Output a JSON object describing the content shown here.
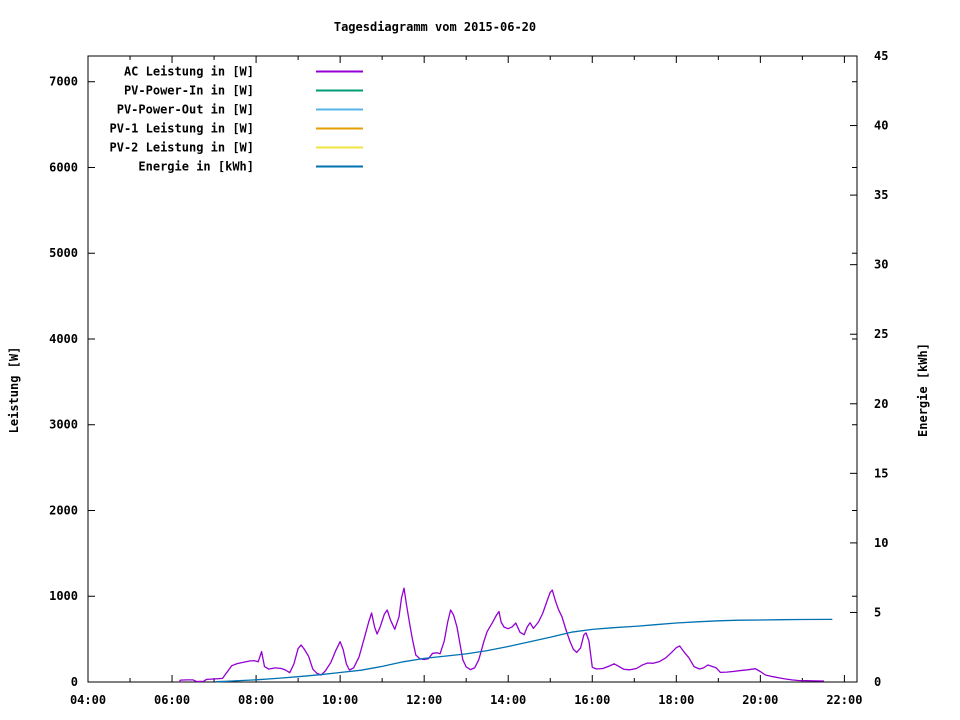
{
  "chart_data": {
    "type": "line",
    "title": "Tagesdiagramm vom 2015-06-20",
    "xlabel": "",
    "ylabel_left": "Leistung [W]",
    "ylabel_right": "Energie [kWh]",
    "grid": false,
    "legend_position": "top-left-inside",
    "x_range_hours": [
      4,
      22.3
    ],
    "x_tick_hours": [
      4,
      6,
      8,
      10,
      12,
      14,
      16,
      18,
      20,
      22
    ],
    "x_tick_labels": [
      "04:00",
      "06:00",
      "08:00",
      "10:00",
      "12:00",
      "14:00",
      "16:00",
      "18:00",
      "20:00",
      "22:00"
    ],
    "x_minor_hours": [
      5,
      7,
      9,
      11,
      13,
      15,
      17,
      19,
      21
    ],
    "y_left_range": [
      0,
      7300
    ],
    "y_left_ticks": [
      0,
      1000,
      2000,
      3000,
      4000,
      5000,
      6000,
      7000
    ],
    "y_right_range": [
      0,
      45
    ],
    "y_right_ticks": [
      0,
      5,
      10,
      15,
      20,
      25,
      30,
      35,
      40,
      45
    ],
    "series": [
      {
        "name": "AC Leistung in [W]",
        "color": "#9400d3",
        "axis": "left",
        "points": [
          [
            6.17,
            0
          ],
          [
            6.2,
            22
          ],
          [
            6.35,
            25
          ],
          [
            6.5,
            25
          ],
          [
            6.58,
            6
          ],
          [
            6.75,
            8
          ],
          [
            6.82,
            30
          ],
          [
            7.0,
            35
          ],
          [
            7.2,
            42
          ],
          [
            7.3,
            110
          ],
          [
            7.42,
            190
          ],
          [
            7.55,
            215
          ],
          [
            7.7,
            230
          ],
          [
            7.85,
            245
          ],
          [
            7.95,
            250
          ],
          [
            8.05,
            235
          ],
          [
            8.13,
            355
          ],
          [
            8.2,
            180
          ],
          [
            8.3,
            150
          ],
          [
            8.45,
            165
          ],
          [
            8.6,
            158
          ],
          [
            8.7,
            140
          ],
          [
            8.8,
            108
          ],
          [
            8.9,
            210
          ],
          [
            9.0,
            390
          ],
          [
            9.07,
            432
          ],
          [
            9.15,
            380
          ],
          [
            9.25,
            300
          ],
          [
            9.35,
            150
          ],
          [
            9.45,
            100
          ],
          [
            9.55,
            82
          ],
          [
            9.65,
            130
          ],
          [
            9.78,
            230
          ],
          [
            9.9,
            370
          ],
          [
            10.0,
            470
          ],
          [
            10.07,
            380
          ],
          [
            10.15,
            210
          ],
          [
            10.22,
            140
          ],
          [
            10.32,
            165
          ],
          [
            10.45,
            290
          ],
          [
            10.58,
            520
          ],
          [
            10.68,
            700
          ],
          [
            10.75,
            805
          ],
          [
            10.82,
            640
          ],
          [
            10.88,
            560
          ],
          [
            10.95,
            640
          ],
          [
            11.05,
            790
          ],
          [
            11.12,
            840
          ],
          [
            11.2,
            720
          ],
          [
            11.3,
            615
          ],
          [
            11.4,
            760
          ],
          [
            11.46,
            980
          ],
          [
            11.52,
            1095
          ],
          [
            11.58,
            900
          ],
          [
            11.65,
            690
          ],
          [
            11.72,
            500
          ],
          [
            11.8,
            315
          ],
          [
            11.9,
            270
          ],
          [
            12.0,
            262
          ],
          [
            12.1,
            272
          ],
          [
            12.2,
            335
          ],
          [
            12.3,
            340
          ],
          [
            12.38,
            330
          ],
          [
            12.48,
            480
          ],
          [
            12.56,
            700
          ],
          [
            12.63,
            840
          ],
          [
            12.7,
            780
          ],
          [
            12.78,
            640
          ],
          [
            12.85,
            450
          ],
          [
            12.92,
            260
          ],
          [
            13.0,
            175
          ],
          [
            13.1,
            145
          ],
          [
            13.2,
            165
          ],
          [
            13.3,
            260
          ],
          [
            13.42,
            470
          ],
          [
            13.5,
            590
          ],
          [
            13.62,
            690
          ],
          [
            13.72,
            780
          ],
          [
            13.78,
            822
          ],
          [
            13.83,
            700
          ],
          [
            13.9,
            640
          ],
          [
            14.0,
            622
          ],
          [
            14.1,
            645
          ],
          [
            14.18,
            688
          ],
          [
            14.28,
            580
          ],
          [
            14.38,
            552
          ],
          [
            14.45,
            640
          ],
          [
            14.52,
            690
          ],
          [
            14.6,
            625
          ],
          [
            14.72,
            700
          ],
          [
            14.82,
            800
          ],
          [
            14.92,
            940
          ],
          [
            15.0,
            1045
          ],
          [
            15.05,
            1072
          ],
          [
            15.12,
            950
          ],
          [
            15.2,
            842
          ],
          [
            15.28,
            760
          ],
          [
            15.38,
            600
          ],
          [
            15.47,
            472
          ],
          [
            15.55,
            380
          ],
          [
            15.63,
            345
          ],
          [
            15.72,
            395
          ],
          [
            15.8,
            550
          ],
          [
            15.85,
            572
          ],
          [
            15.92,
            480
          ],
          [
            16.0,
            172
          ],
          [
            16.1,
            152
          ],
          [
            16.25,
            158
          ],
          [
            16.4,
            185
          ],
          [
            16.52,
            212
          ],
          [
            16.62,
            185
          ],
          [
            16.75,
            148
          ],
          [
            16.9,
            142
          ],
          [
            17.05,
            158
          ],
          [
            17.2,
            200
          ],
          [
            17.32,
            222
          ],
          [
            17.45,
            218
          ],
          [
            17.6,
            238
          ],
          [
            17.75,
            282
          ],
          [
            17.88,
            342
          ],
          [
            18.0,
            400
          ],
          [
            18.08,
            420
          ],
          [
            18.18,
            352
          ],
          [
            18.3,
            282
          ],
          [
            18.42,
            180
          ],
          [
            18.55,
            152
          ],
          [
            18.65,
            165
          ],
          [
            18.75,
            198
          ],
          [
            18.85,
            182
          ],
          [
            18.95,
            165
          ],
          [
            19.05,
            112
          ],
          [
            19.2,
            115
          ],
          [
            19.35,
            122
          ],
          [
            19.5,
            132
          ],
          [
            19.7,
            142
          ],
          [
            19.88,
            155
          ],
          [
            20.0,
            122
          ],
          [
            20.12,
            82
          ],
          [
            20.3,
            62
          ],
          [
            20.45,
            48
          ],
          [
            20.6,
            35
          ],
          [
            20.75,
            25
          ],
          [
            20.9,
            18
          ],
          [
            21.1,
            15
          ],
          [
            21.3,
            13
          ],
          [
            21.5,
            12
          ]
        ]
      },
      {
        "name": "PV-Power-In in [W]",
        "color": "#009e73",
        "axis": "left",
        "points": []
      },
      {
        "name": "PV-Power-Out in [W]",
        "color": "#56b4e9",
        "axis": "left",
        "points": []
      },
      {
        "name": "PV-1 Leistung in [W]",
        "color": "#e69f00",
        "axis": "left",
        "points": []
      },
      {
        "name": "PV-2 Leistung in [W]",
        "color": "#f0e442",
        "axis": "left",
        "points": []
      },
      {
        "name": "Energie in [kWh]",
        "color": "#0072b2",
        "axis": "right",
        "points": [
          [
            7.05,
            0.02
          ],
          [
            7.3,
            0.05
          ],
          [
            7.6,
            0.1
          ],
          [
            8.0,
            0.16
          ],
          [
            8.5,
            0.26
          ],
          [
            9.0,
            0.38
          ],
          [
            9.5,
            0.52
          ],
          [
            10.0,
            0.68
          ],
          [
            10.5,
            0.85
          ],
          [
            11.0,
            1.12
          ],
          [
            11.5,
            1.45
          ],
          [
            12.0,
            1.7
          ],
          [
            12.5,
            1.86
          ],
          [
            13.0,
            2.02
          ],
          [
            13.5,
            2.26
          ],
          [
            14.0,
            2.55
          ],
          [
            14.5,
            2.88
          ],
          [
            15.0,
            3.22
          ],
          [
            15.5,
            3.58
          ],
          [
            16.0,
            3.78
          ],
          [
            16.5,
            3.9
          ],
          [
            17.0,
            4.0
          ],
          [
            17.5,
            4.12
          ],
          [
            18.0,
            4.24
          ],
          [
            18.5,
            4.33
          ],
          [
            19.0,
            4.4
          ],
          [
            19.5,
            4.44
          ],
          [
            20.0,
            4.46
          ],
          [
            20.5,
            4.48
          ],
          [
            21.0,
            4.49
          ],
          [
            21.7,
            4.5
          ]
        ]
      }
    ]
  },
  "colors": {
    "axis": "#000000",
    "background": "#ffffff"
  }
}
